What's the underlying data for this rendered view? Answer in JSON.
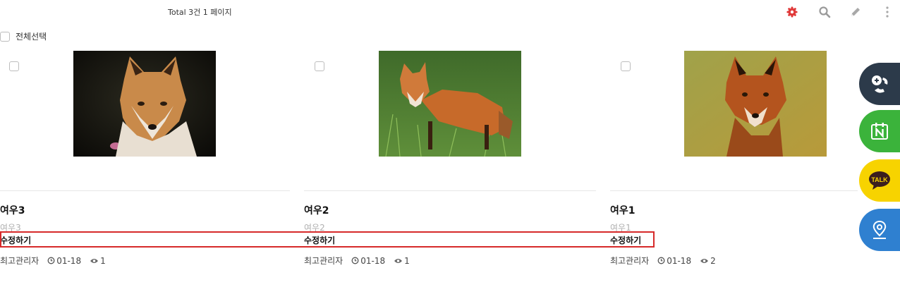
{
  "header": {
    "total_text": "Total 3건 1 페이지",
    "tools": [
      {
        "icon": "gear-icon",
        "color": "#e03a3a"
      },
      {
        "icon": "search-icon",
        "color": "#9a9a9a"
      },
      {
        "icon": "pencil-icon",
        "color": "#a8a8a8"
      },
      {
        "icon": "more-vertical-icon",
        "color": "#a8a8a8"
      }
    ]
  },
  "select_all": {
    "label": "전체선택"
  },
  "posts": [
    {
      "title": "여우3",
      "summary": "여우3",
      "edit_label": "수정하기",
      "author": "최고관리자",
      "date": "01-18",
      "views": "1",
      "image": "fox-portrait-photo"
    },
    {
      "title": "여우2",
      "summary": "여우2",
      "edit_label": "수정하기",
      "author": "최고관리자",
      "date": "01-18",
      "views": "1",
      "image": "fox-in-grass-photo"
    },
    {
      "title": "여우1",
      "summary": "여우1",
      "edit_label": "수정하기",
      "author": "최고관리자",
      "date": "01-18",
      "views": "2",
      "image": "red-fox-field-photo"
    }
  ],
  "quick_buttons": [
    {
      "icon": "phone-plus-icon",
      "color": "#2c3a4a"
    },
    {
      "icon": "naver-calendar-icon",
      "color": "#3bb33b"
    },
    {
      "icon": "kakao-talk-icon",
      "color": "#f7d300",
      "label": "TALK"
    },
    {
      "icon": "map-pin-icon",
      "color": "#2f80d0"
    }
  ]
}
